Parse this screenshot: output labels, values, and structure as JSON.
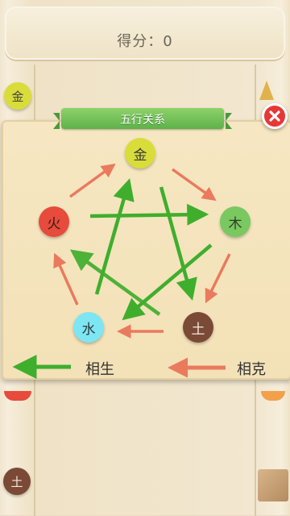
{
  "score": {
    "text": "得分：0"
  },
  "background": {
    "chip_top_left": "金",
    "chip_bottom_left": "土"
  },
  "panel": {
    "title": "五行关系",
    "elements": {
      "metal": {
        "label": "金",
        "color": "#d9dd3a",
        "text_color": "#3a3a3a"
      },
      "wood": {
        "label": "木",
        "color": "#79c860",
        "text_color": "#2f3b2a"
      },
      "earth": {
        "label": "土",
        "color": "#7a4a36",
        "text_color": "#f3e7dc"
      },
      "water": {
        "label": "水",
        "color": "#7ee6f2",
        "text_color": "#2b3a40"
      },
      "fire": {
        "label": "火",
        "color": "#e64b3b",
        "text_color": "#3a1a16"
      }
    },
    "generating_cycle": [
      "金",
      "木",
      "土",
      "水",
      "火"
    ],
    "overcoming_cycle": [
      "金",
      "木",
      "土",
      "水",
      "火"
    ],
    "legend": {
      "generate_label": "相生",
      "generate_color": "#3fae2d",
      "overcome_label": "相克",
      "overcome_color": "#ea7a5e"
    }
  }
}
